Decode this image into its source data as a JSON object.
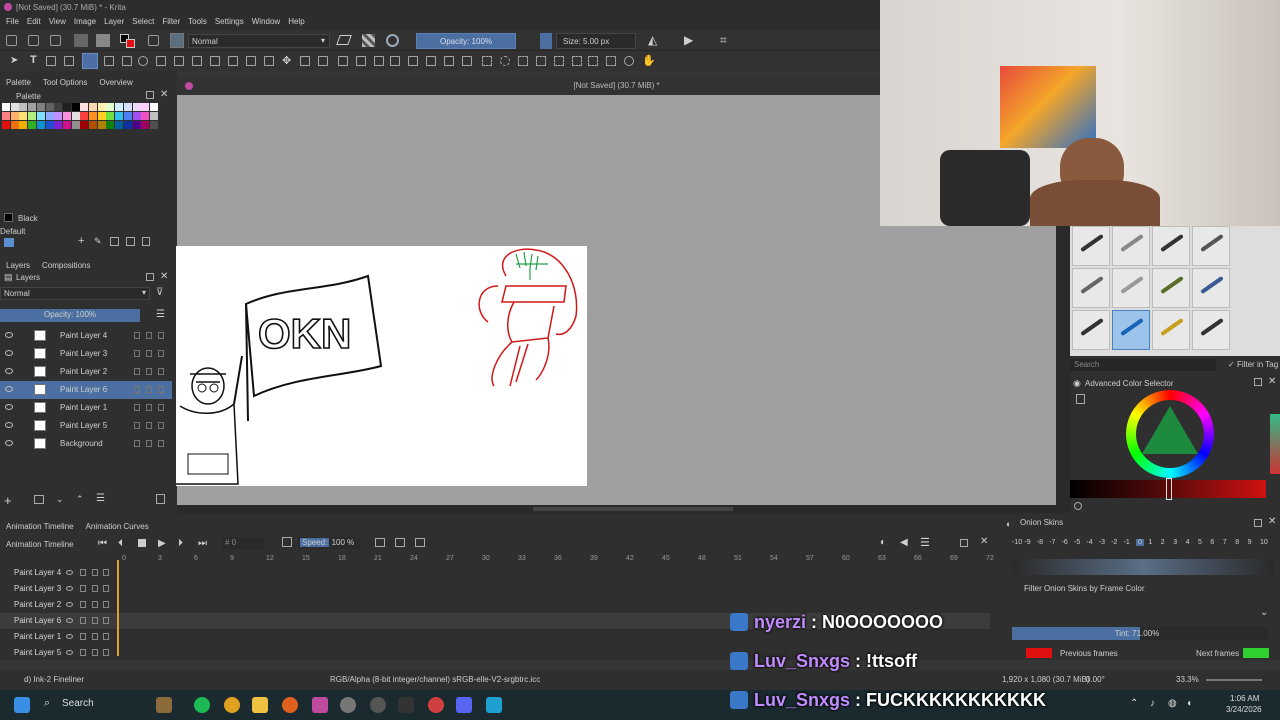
{
  "window": {
    "title": "[Not Saved]  (30.7 MiB) * - Krita"
  },
  "menu": [
    "File",
    "Edit",
    "View",
    "Image",
    "Layer",
    "Select",
    "Filter",
    "Tools",
    "Settings",
    "Window",
    "Help"
  ],
  "toolbar": {
    "blend_mode": "Normal",
    "opacity": "Opacity: 100%",
    "size": "Size: 5.00 px"
  },
  "left_dock": {
    "tabs": [
      "Palette",
      "Tool Options",
      "Overview"
    ],
    "palette_title": "Palette",
    "current_color": "Black",
    "palette_name": "Default"
  },
  "layers_dock": {
    "tabs": [
      "Layers",
      "Compositions"
    ],
    "blend_mode": "Normal",
    "opacity": "Opacity:  100%",
    "layers": [
      {
        "name": "Paint Layer 4"
      },
      {
        "name": "Paint Layer 3"
      },
      {
        "name": "Paint Layer 2"
      },
      {
        "name": "Paint Layer 6"
      },
      {
        "name": "Paint Layer 1"
      },
      {
        "name": "Paint Layer 5"
      },
      {
        "name": "Background"
      }
    ],
    "selected_index": 3
  },
  "document": {
    "title": "[Not Saved]  (30.7 MiB) *",
    "drawing_text": "OKN"
  },
  "right_panel": {
    "search_placeholder": "Search",
    "filter_in_tag": "Filter in Tag",
    "color_selector_title": "Advanced Color Selector"
  },
  "timeline": {
    "tabs": [
      "Animation Timeline",
      "Animation Curves"
    ],
    "title": "Animation Timeline",
    "frame": "0",
    "speed_label": "Speed:",
    "speed_value": "100 %",
    "ruler": [
      "0",
      "3",
      "6",
      "9",
      "12",
      "15",
      "18",
      "21",
      "24",
      "27",
      "30",
      "33",
      "36",
      "39",
      "42",
      "45",
      "48",
      "51",
      "54",
      "57",
      "60",
      "63",
      "66",
      "69",
      "72"
    ],
    "rows": [
      "Paint Layer 4",
      "Paint Layer 3",
      "Paint Layer 2",
      "Paint Layer 6",
      "Paint Layer 1",
      "Paint Layer 5"
    ]
  },
  "onion": {
    "title": "Onion Skins",
    "numbers": [
      "-10",
      "-9",
      "-8",
      "-7",
      "-6",
      "-5",
      "-4",
      "-3",
      "-2",
      "-1",
      "0",
      "1",
      "2",
      "3",
      "4",
      "5",
      "6",
      "7",
      "8",
      "9",
      "10"
    ],
    "filter_label": "Filter Onion Skins by Frame Color",
    "tint": "Tint: 71.00%",
    "tint_fraction": 0.5,
    "previous_frames": "Previous frames",
    "next_frames": "Next frames",
    "previous_color": "#e01010",
    "next_color": "#30d030"
  },
  "statusbar": {
    "brush": "d) Ink-2 Fineliner",
    "color_info": "RGB/Alpha (8-bit integer/channel)  sRGB-elle-V2-srgbtrc.icc",
    "image_size": "1,920 x 1,080 (30.7 MiB)",
    "rotation": "0.00°",
    "zoom": "33.3%"
  },
  "chat": [
    {
      "user": "nyerzi",
      "message": " : N0OOOOOOO"
    },
    {
      "user": "Luv_Snxgs",
      "message": " : !ttsoff"
    },
    {
      "user": "Luv_Snxgs",
      "message": " : FUCKKKKKKKKKKK"
    }
  ],
  "taskbar": {
    "search": "Search",
    "time": "1:06 AM",
    "date": "3/24/2026"
  }
}
